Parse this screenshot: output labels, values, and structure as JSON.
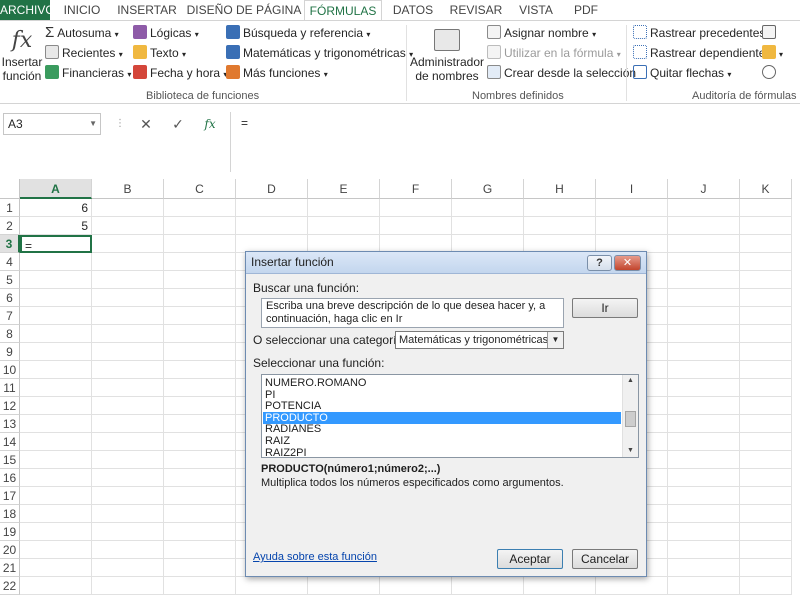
{
  "tabs": [
    "ARCHIVO",
    "INICIO",
    "INSERTAR",
    "DISEÑO DE PÁGINA",
    "FÓRMULAS",
    "DATOS",
    "REVISAR",
    "VISTA",
    "PDF"
  ],
  "active_tab": "FÓRMULAS",
  "ribbon": {
    "insert_function": "Insertar función",
    "library": {
      "autosum": "Autosuma",
      "recent": "Recientes",
      "financial": "Financieras",
      "logical": "Lógicas",
      "text": "Texto",
      "datetime": "Fecha y hora",
      "lookup": "Búsqueda y referencia",
      "math": "Matemáticas y trigonométricas",
      "more": "Más funciones",
      "group_label": "Biblioteca de funciones"
    },
    "names": {
      "name_manager": "Administrador de nombres",
      "define_name": "Asignar nombre",
      "use_in_formula": "Utilizar en la fórmula",
      "create_from_selection": "Crear desde la selección",
      "group_label": "Nombres definidos"
    },
    "audit": {
      "trace_precedents": "Rastrear precedentes",
      "trace_dependents": "Rastrear dependientes",
      "remove_arrows": "Quitar flechas",
      "group_label": "Auditoría de fórmulas"
    }
  },
  "formula_bar": {
    "name_box": "A3",
    "fx": "fx",
    "content": "="
  },
  "grid": {
    "columns": [
      "A",
      "B",
      "C",
      "D",
      "E",
      "F",
      "G",
      "H",
      "I",
      "J",
      "K"
    ],
    "rows": [
      "1",
      "2",
      "3",
      "4",
      "5",
      "6",
      "7",
      "8",
      "9",
      "10",
      "11",
      "12",
      "13",
      "14",
      "15",
      "16",
      "17",
      "18",
      "19",
      "20",
      "21",
      "22"
    ],
    "cells": {
      "A1": "6",
      "A2": "5",
      "A3": "="
    },
    "active_cell": "A3"
  },
  "dialog": {
    "title": "Insertar función",
    "help_btn": "?",
    "close_btn": "✕",
    "search_label": "Buscar una función:",
    "search_text": "Escriba una breve descripción de lo que desea hacer y, a continuación, haga clic en Ir",
    "go_btn": "Ir",
    "category_label": "O seleccionar una categoría:",
    "category_value": "Matemáticas y trigonométricas",
    "select_label": "Seleccionar una función:",
    "functions": [
      "NUMERO.ROMANO",
      "PI",
      "POTENCIA",
      "PRODUCTO",
      "RADIANES",
      "RAIZ",
      "RAIZ2PI"
    ],
    "selected_function": "PRODUCTO",
    "signature": "PRODUCTO(número1;número2;...)",
    "description": "Multiplica todos los números especificados como argumentos.",
    "help_link": "Ayuda sobre esta función",
    "accept_btn": "Aceptar",
    "cancel_btn": "Cancelar"
  },
  "colors": {
    "excel_green": "#217346",
    "selection_blue": "#3399ff",
    "link_blue": "#0645ad"
  }
}
